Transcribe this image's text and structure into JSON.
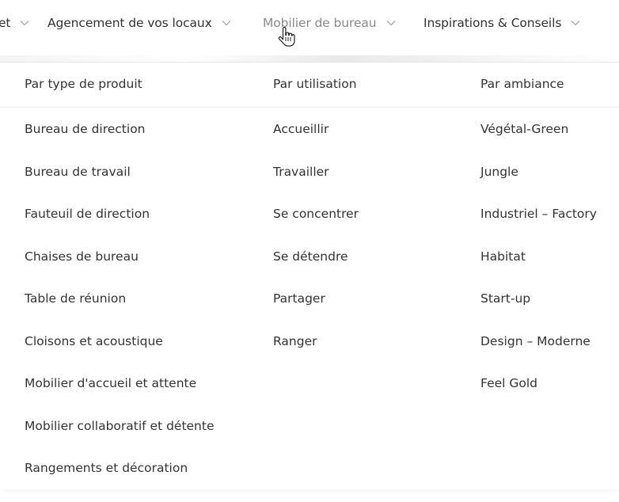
{
  "nav": {
    "items": [
      {
        "label": "et"
      },
      {
        "label": "Agencement de vos locaux"
      },
      {
        "label": "Mobilier de bureau"
      },
      {
        "label": "Inspirations & Conseils"
      }
    ]
  },
  "mega_menu": {
    "columns": [
      {
        "title": "Par type de produit",
        "links": [
          "Bureau de direction",
          "Bureau de travail",
          "Fauteuil de direction",
          "Chaises de bureau",
          "Table de réunion",
          "Cloisons et acoustique",
          "Mobilier d'accueil et attente",
          "Mobilier collaboratif et détente",
          "Rangements et décoration"
        ]
      },
      {
        "title": "Par utilisation",
        "links": [
          "Accueillir",
          "Travailler",
          "Se concentrer",
          "Se détendre",
          "Partager",
          "Ranger"
        ]
      },
      {
        "title": "Par ambiance",
        "links": [
          "Végétal-Green",
          "Jungle",
          "Industriel – Factory",
          "Habitat",
          "Start-up",
          "Design – Moderne",
          "Feel Gold"
        ]
      }
    ]
  },
  "colors": {
    "text": "#333336",
    "active_text": "#8a8a8e",
    "chevron": "#a9a9ad"
  }
}
